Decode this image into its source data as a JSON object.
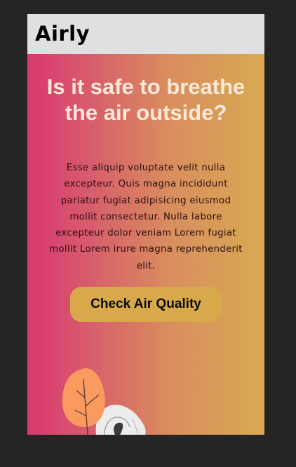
{
  "navbar": {
    "logo_text": "Airly"
  },
  "hero": {
    "headline": "Is it safe to breathe the air outside?",
    "body": "Esse aliquip voluptate velit nulla excepteur. Quis magna incididunt pariatur fugiat adipisicing eiusmod mollit consectetur. Nulla labore excepteur dolor veniam Lorem fugiat mollit Lorem irure magna reprehenderit elit.",
    "cta_label": "Check Air Quality"
  },
  "colors": {
    "navbar_bg": "#e0e0e0",
    "gradient_start": "#d9376f",
    "gradient_end": "#d8aa52",
    "headline": "#fde9d9",
    "button_bg": "#d8a94b",
    "leaf": "#fb9a5e"
  },
  "illustration": {
    "name": "leaf-and-stones-illustration"
  }
}
